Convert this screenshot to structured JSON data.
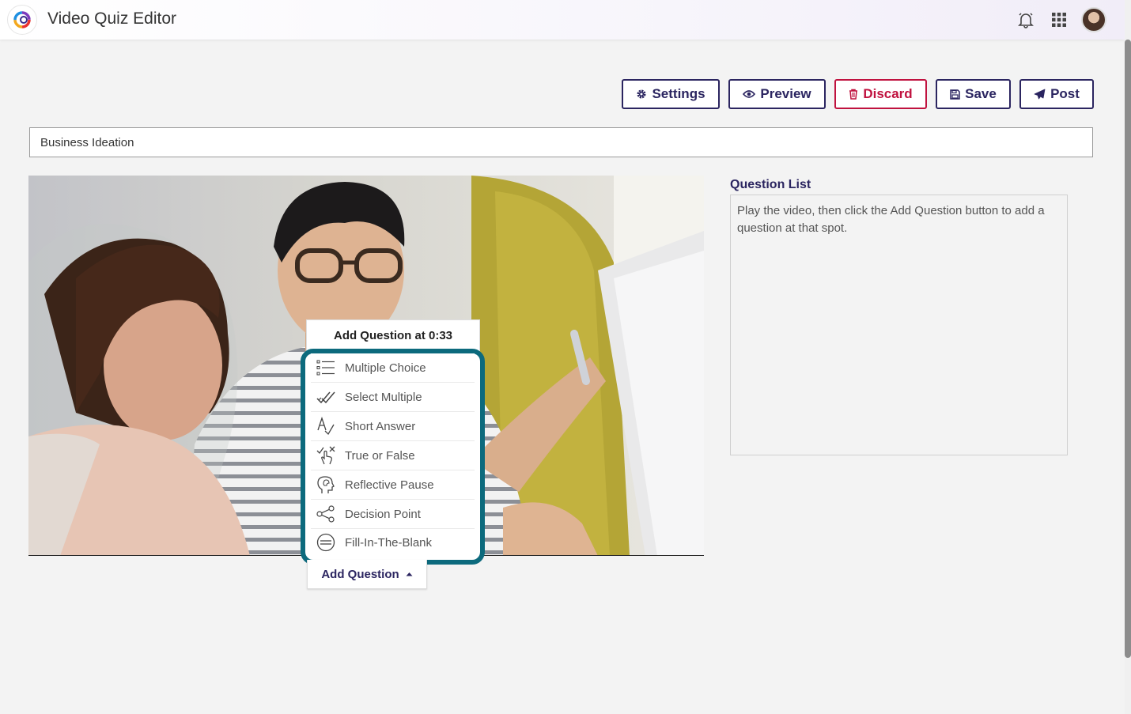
{
  "app": {
    "title": "Video Quiz Editor"
  },
  "toolbar": {
    "settings_label": "Settings",
    "preview_label": "Preview",
    "discard_label": "Discard",
    "save_label": "Save",
    "post_label": "Post"
  },
  "quiz": {
    "title_value": "Business Ideation"
  },
  "question_list": {
    "heading": "Question List",
    "empty_text": "Play the video, then click the Add Question button to add a question at that spot."
  },
  "add_menu": {
    "header": "Add Question at 0:33",
    "items": [
      {
        "label": "Multiple Choice",
        "icon": "list-icon"
      },
      {
        "label": "Select Multiple",
        "icon": "double-check-icon"
      },
      {
        "label": "Short Answer",
        "icon": "spell-check-icon"
      },
      {
        "label": "True or False",
        "icon": "check-x-pointer-icon"
      },
      {
        "label": "Reflective Pause",
        "icon": "head-thought-icon"
      },
      {
        "label": "Decision Point",
        "icon": "share-nodes-icon"
      },
      {
        "label": "Fill-In-The-Blank",
        "icon": "circle-lines-icon"
      }
    ],
    "button_label": "Add Question"
  },
  "colors": {
    "brand": "#2b2560",
    "danger": "#c0123f",
    "highlight": "#0c6a7d"
  }
}
